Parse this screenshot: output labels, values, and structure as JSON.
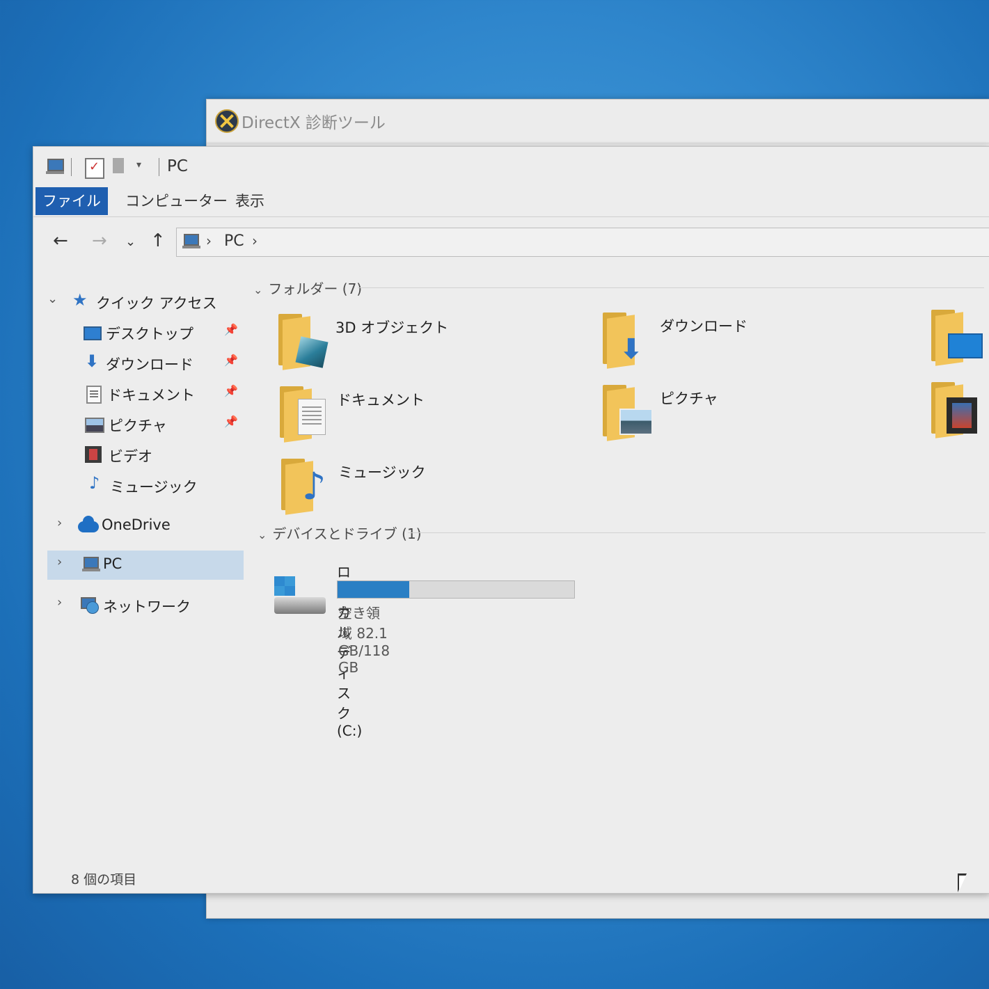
{
  "dx_window": {
    "title": "DirectX 診断ツール"
  },
  "explorer": {
    "qat_title": "PC",
    "tabs": [
      {
        "label": "ファイル"
      },
      {
        "label": "コンピューター"
      },
      {
        "label": "表示"
      }
    ],
    "address": {
      "path": "PC"
    },
    "nav": {
      "quick_access": "クイック アクセス",
      "items": [
        {
          "label": "デスクトップ",
          "pinned": true
        },
        {
          "label": "ダウンロード",
          "pinned": true
        },
        {
          "label": "ドキュメント",
          "pinned": true
        },
        {
          "label": "ピクチャ",
          "pinned": true
        },
        {
          "label": "ビデオ",
          "pinned": false
        },
        {
          "label": "ミュージック",
          "pinned": false
        }
      ],
      "onedrive": "OneDrive",
      "pc": "PC",
      "network": "ネットワーク"
    },
    "content": {
      "folders_header": "フォルダー (7)",
      "folders": [
        {
          "label": "3D オブジェクト",
          "icon": "3d-objects-folder-icon"
        },
        {
          "label": "ダウンロード",
          "icon": "downloads-folder-icon"
        },
        {
          "label": "ドキュメント",
          "icon": "documents-folder-icon"
        },
        {
          "label": "ピクチャ",
          "icon": "pictures-folder-icon"
        },
        {
          "label": "ミュージック",
          "icon": "music-folder-icon"
        }
      ],
      "devices_header": "デバイスとドライブ (1)",
      "drive": {
        "name": "ローカル ディスク (C:)",
        "free_text": "空き領域 82.1 GB/118 GB",
        "used_fraction": 0.304
      }
    },
    "status": {
      "item_count": "8 個の項目"
    },
    "colors": {
      "accent": "#1f5fb0",
      "selected_bg": "#c7d9ea",
      "drive_fill": "#2a7fc4"
    }
  }
}
